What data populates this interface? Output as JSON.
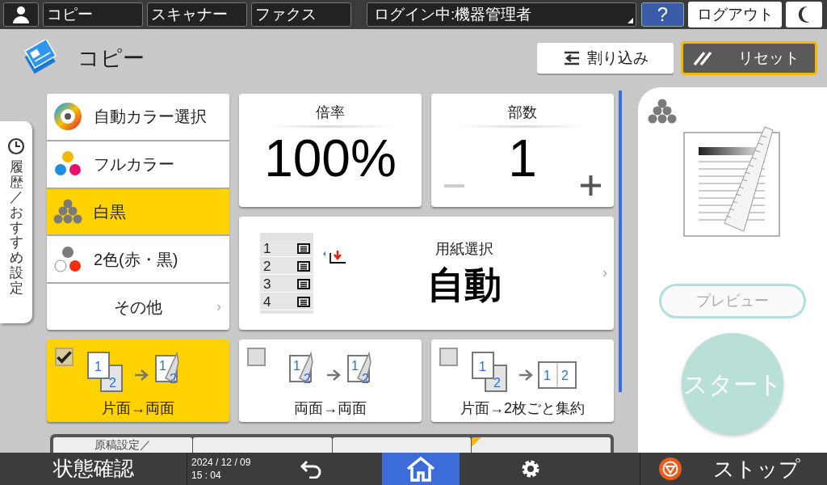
{
  "top_bar": {
    "apps": [
      "コピー",
      "スキャナー",
      "ファクス"
    ],
    "login": "ログイン中:機器管理者",
    "help": "?",
    "logout": "ログアウト"
  },
  "header": {
    "title": "コピー",
    "interrupt": "割り込み",
    "reset": "リセット"
  },
  "history_tab": "履歴／おすすめ設定",
  "color_modes": [
    {
      "kind": "auto",
      "label": "自動カラー選択",
      "selected": false
    },
    {
      "kind": "full",
      "label": "フルカラー",
      "selected": false
    },
    {
      "kind": "mono",
      "label": "白黒",
      "selected": true
    },
    {
      "kind": "two",
      "label": "2色(赤・黒)",
      "selected": false
    },
    {
      "kind": "more",
      "label": "その他",
      "selected": false,
      "chevron": "›"
    }
  ],
  "ratio": {
    "label": "倍率",
    "value": "100%"
  },
  "copies": {
    "label": "部数",
    "value": "1",
    "minus_disabled": true
  },
  "paper": {
    "label": "用紙選択",
    "value": "自動",
    "trays": [
      "1",
      "2",
      "3",
      "4"
    ],
    "chevron": "›"
  },
  "duplex": [
    {
      "kind": "one_to_two",
      "label": "片面→両面",
      "checked": true,
      "pages": [
        "1",
        "2",
        "1",
        "2"
      ]
    },
    {
      "kind": "two_to_two",
      "label": "両面→両面",
      "checked": false,
      "pages": [
        "1",
        "2",
        "1",
        "2"
      ]
    },
    {
      "kind": "combine",
      "label": "片面→2枚ごと集約",
      "checked": false,
      "pages": [
        "1",
        "2",
        "1",
        "2"
      ]
    }
  ],
  "setting_tabs": [
    {
      "label": "原稿設定／",
      "marked": false
    },
    {
      "marked": false
    },
    {
      "marked": false
    },
    {
      "marked": true
    }
  ],
  "preview": {
    "label": "プレビュー",
    "disabled": true
  },
  "start": {
    "label": "スタート",
    "disabled": true
  },
  "status_bar": {
    "status": "状態確認",
    "date": "2024 / 12 / 09",
    "time": "15 : 04",
    "nav": [
      {
        "kind": "back",
        "selected": false
      },
      {
        "kind": "home",
        "selected": true
      },
      {
        "kind": "settings",
        "selected": false
      }
    ],
    "stop": "ストップ"
  }
}
